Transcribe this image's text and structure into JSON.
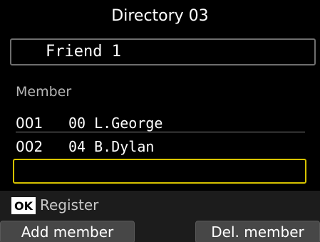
{
  "header": {
    "title": "Directory 03"
  },
  "group_name": {
    "value": "Friend 1"
  },
  "members": {
    "label": "Member",
    "items": [
      {
        "number": "001",
        "entry": "00 L.George"
      },
      {
        "number": "002",
        "entry": "04 B.Dylan"
      }
    ],
    "new_entry_value": ""
  },
  "footer": {
    "ok_key": "OK",
    "ok_action": "Register",
    "left_soft_key": "Add member",
    "right_soft_key": "Del. member"
  },
  "colors": {
    "background": "#000000",
    "selection_border": "#d6c200",
    "soft_key": "#474747"
  }
}
